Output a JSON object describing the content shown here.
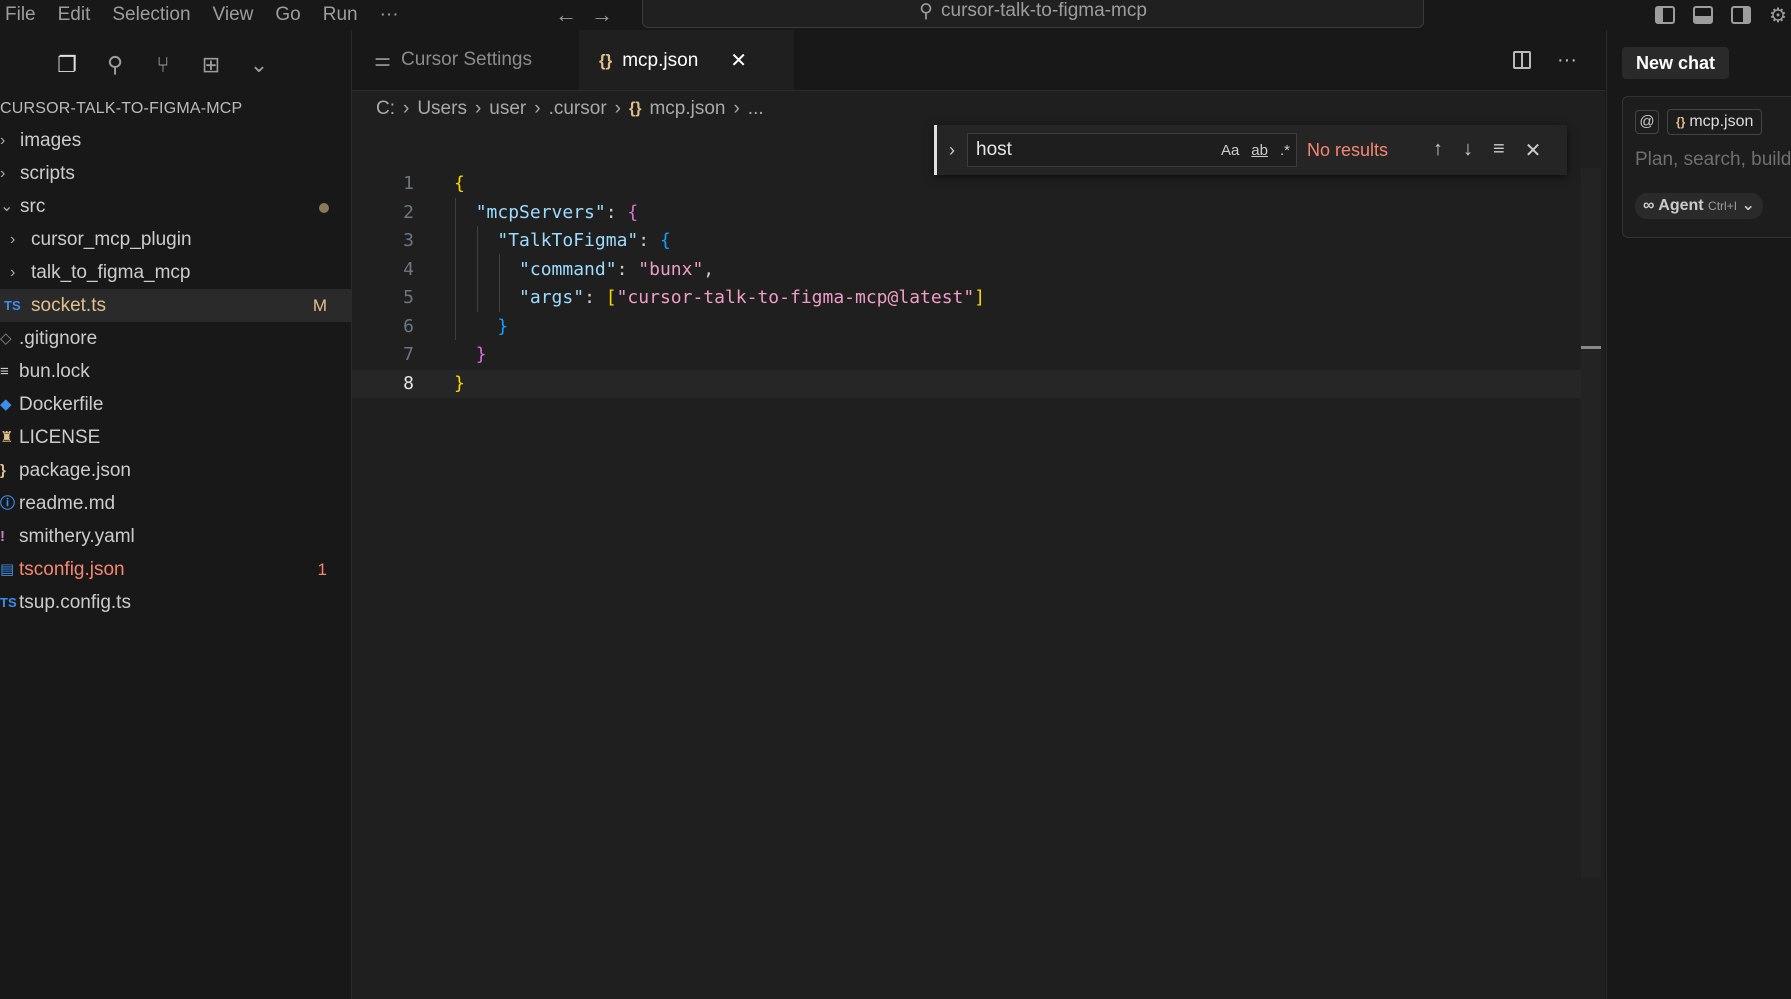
{
  "menu": [
    "File",
    "Edit",
    "Selection",
    "View",
    "Go",
    "Run",
    "···"
  ],
  "command_center": "cursor-talk-to-figma-mcp",
  "explorer": {
    "title": "CURSOR-TALK-TO-FIGMA-MCP",
    "items": [
      {
        "label": "images",
        "kind": "folder"
      },
      {
        "label": "scripts",
        "kind": "folder"
      },
      {
        "label": "src",
        "kind": "folder-open"
      },
      {
        "label": "cursor_mcp_plugin",
        "kind": "subfolder"
      },
      {
        "label": "talk_to_figma_mcp",
        "kind": "subfolder"
      },
      {
        "label": "socket.ts",
        "kind": "file",
        "icon": "TS",
        "badge": "M"
      },
      {
        "label": ".gitignore",
        "kind": "file"
      },
      {
        "label": "bun.lock",
        "kind": "file"
      },
      {
        "label": "Dockerfile",
        "kind": "file"
      },
      {
        "label": "LICENSE",
        "kind": "file"
      },
      {
        "label": "package.json",
        "kind": "file"
      },
      {
        "label": "readme.md",
        "kind": "file"
      },
      {
        "label": "smithery.yaml",
        "kind": "file"
      },
      {
        "label": "tsconfig.json",
        "kind": "file",
        "badge": "1"
      },
      {
        "label": "tsup.config.ts",
        "kind": "file",
        "icon": "TS"
      }
    ]
  },
  "tabs": [
    {
      "label": "Cursor Settings",
      "active": false
    },
    {
      "label": "mcp.json",
      "active": true,
      "icon": "{}"
    }
  ],
  "breadcrumb": [
    "C:",
    "Users",
    "user",
    ".cursor",
    "mcp.json",
    "..."
  ],
  "find": {
    "query": "host",
    "opt_case": "Aa",
    "opt_word": "ab",
    "opt_regex": ".*",
    "status": "No results"
  },
  "code": {
    "line_numbers": [
      "1",
      "2",
      "3",
      "4",
      "5",
      "6",
      "7",
      "8"
    ],
    "current_line": 8,
    "tokens": {
      "l1_open": "{",
      "l2_key": "\"mcpServers\"",
      "l2_colon": ": ",
      "l2_open": "{",
      "l3_key": "\"TalkToFigma\"",
      "l3_colon": ": ",
      "l3_open": "{",
      "l4_key": "\"command\"",
      "l4_colon": ": ",
      "l4_val": "\"bunx\"",
      "l4_comma": ",",
      "l5_key": "\"args\"",
      "l5_colon": ": ",
      "l5_open": "[",
      "l5_val": "\"cursor-talk-to-figma-mcp@latest\"",
      "l5_close": "]",
      "l6_close": "}",
      "l7_close": "}",
      "l8_close": "}"
    }
  },
  "chat": {
    "new_chat": "New chat",
    "context_at": "@",
    "context_file": "mcp.json",
    "placeholder": "Plan, search, build",
    "agent_label": "Agent",
    "agent_shortcut": "Ctrl+I"
  }
}
